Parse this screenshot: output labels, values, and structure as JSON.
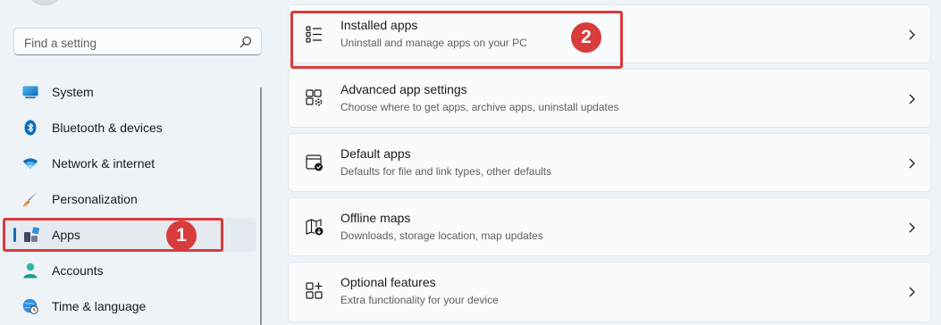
{
  "search": {
    "placeholder": "Find a setting",
    "icon": "search-icon"
  },
  "sidebar": {
    "items": [
      {
        "label": "System",
        "icon": "monitor-icon"
      },
      {
        "label": "Bluetooth & devices",
        "icon": "bluetooth-icon"
      },
      {
        "label": "Network & internet",
        "icon": "wifi-icon"
      },
      {
        "label": "Personalization",
        "icon": "paintbrush-icon"
      },
      {
        "label": "Apps",
        "icon": "apps-icon",
        "selected": true
      },
      {
        "label": "Accounts",
        "icon": "person-icon"
      },
      {
        "label": "Time & language",
        "icon": "globe-clock-icon"
      }
    ]
  },
  "annotations": {
    "step1": "1",
    "step2": "2",
    "color": "#d83b3b"
  },
  "main": {
    "cards": [
      {
        "title": "Installed apps",
        "subtitle": "Uninstall and manage apps on your PC",
        "icon": "list-icon"
      },
      {
        "title": "Advanced app settings",
        "subtitle": "Choose where to get apps, archive apps, uninstall updates",
        "icon": "app-settings-icon"
      },
      {
        "title": "Default apps",
        "subtitle": "Defaults for file and link types, other defaults",
        "icon": "default-apps-icon"
      },
      {
        "title": "Offline maps",
        "subtitle": "Downloads, storage location, map updates",
        "icon": "map-download-icon"
      },
      {
        "title": "Optional features",
        "subtitle": "Extra functionality for your device",
        "icon": "add-features-icon"
      }
    ]
  },
  "colors": {
    "accent": "#0f6cbd",
    "background": "#eef3f8",
    "card": "#f9fbfd"
  }
}
